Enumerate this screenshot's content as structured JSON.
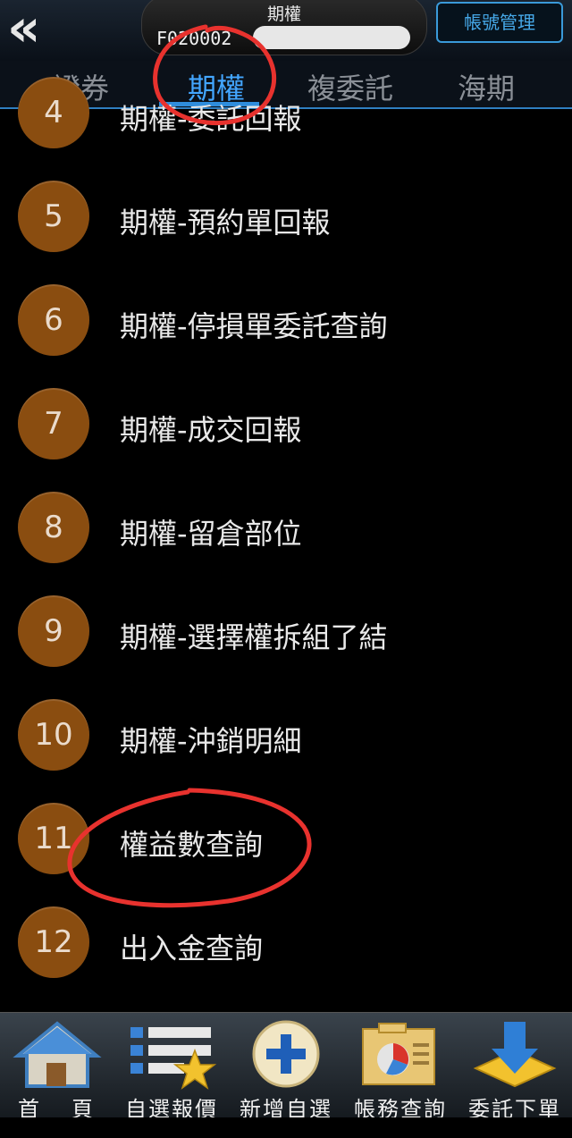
{
  "header": {
    "back_glyph": "«",
    "account_title": "期權",
    "account_id": "F020002",
    "manage_button": "帳號管理"
  },
  "tabs": [
    {
      "label": "證券",
      "active": false
    },
    {
      "label": "期權",
      "active": true
    },
    {
      "label": "複委託",
      "active": false
    },
    {
      "label": "海期",
      "active": false
    }
  ],
  "menu": [
    {
      "num": "4",
      "label": "期權-委託回報"
    },
    {
      "num": "5",
      "label": "期權-預約單回報"
    },
    {
      "num": "6",
      "label": "期權-停損單委託查詢"
    },
    {
      "num": "7",
      "label": "期權-成交回報"
    },
    {
      "num": "8",
      "label": "期權-留倉部位"
    },
    {
      "num": "9",
      "label": "期權-選擇權拆組了結"
    },
    {
      "num": "10",
      "label": "期權-沖銷明細"
    },
    {
      "num": "11",
      "label": "權益數查詢"
    },
    {
      "num": "12",
      "label": "出入金查詢"
    }
  ],
  "bottom_nav": [
    {
      "label": "首頁",
      "icon": "home-icon"
    },
    {
      "label": "自選報價",
      "icon": "watchlist-icon"
    },
    {
      "label": "新增自選",
      "icon": "add-icon"
    },
    {
      "label": "帳務查詢",
      "icon": "account-report-icon"
    },
    {
      "label": "委託下單",
      "icon": "order-down-icon"
    }
  ],
  "colors": {
    "accent": "#2f8ddc",
    "badge": "#8a4d10",
    "annotation": "#e8322e"
  }
}
